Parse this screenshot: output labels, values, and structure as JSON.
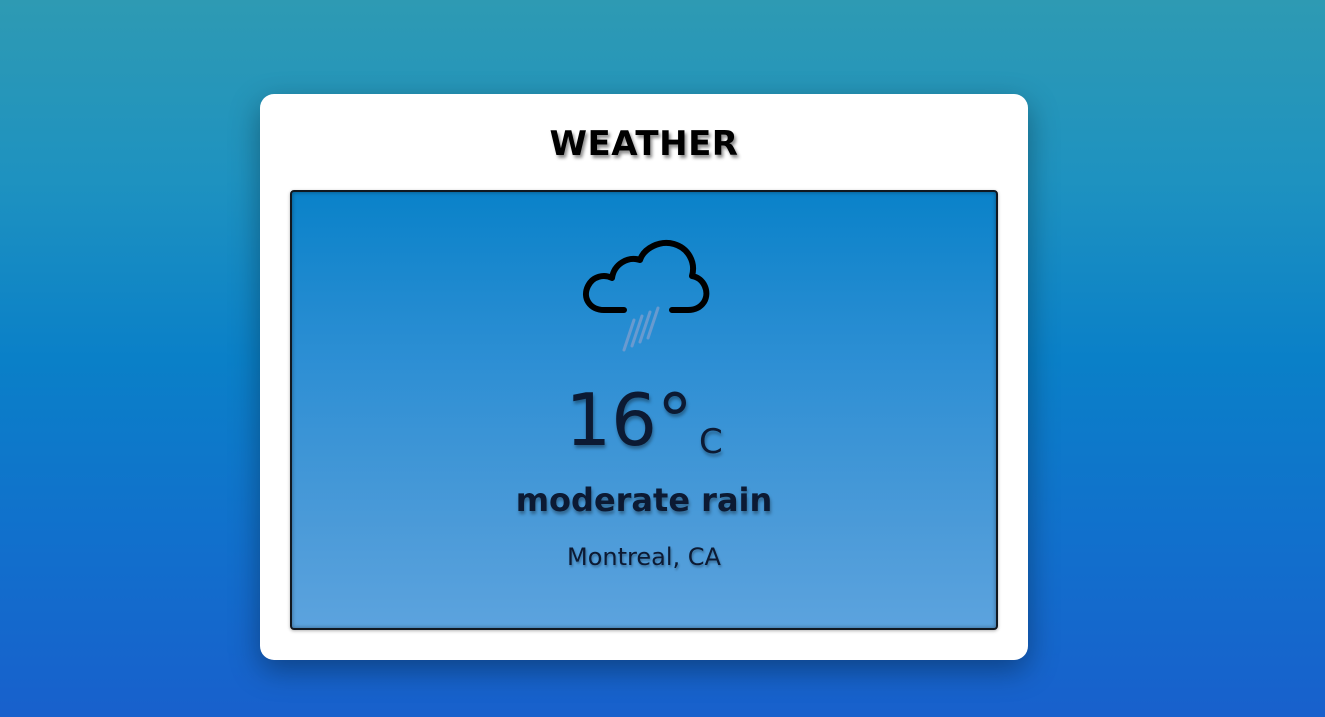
{
  "app": {
    "title": "WEATHER"
  },
  "weather": {
    "icon": "cloud-rain-icon",
    "temperature": "16°",
    "unit": "C",
    "condition": "moderate rain",
    "location": "Montreal, CA"
  },
  "colors": {
    "background_top": "#2e9ab3",
    "background_bottom": "#1860cc",
    "card": "#ffffff",
    "panel_top": "#0a82c9",
    "panel_bottom": "#5ca3de",
    "text_dark": "#0c1a33"
  }
}
